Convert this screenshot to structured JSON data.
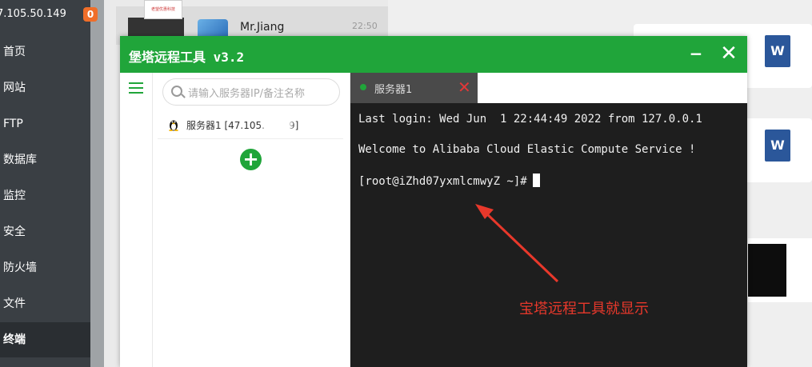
{
  "panel": {
    "ip": "7.105.50.149",
    "badge": "0",
    "nav": [
      "首页",
      "网站",
      "FTP",
      "数据库",
      "监控",
      "安全",
      "防火墙",
      "文件",
      "终端"
    ],
    "active_nav": "终端"
  },
  "chat": {
    "name": "Mr.Jiang",
    "time": "22:50",
    "thumb_text": "老望优惠科技",
    "doc_snippet": "…",
    "word_icon": "W"
  },
  "window": {
    "title": "堡塔远程工具 v3.2",
    "minimize_label": "−",
    "close_label": "✕",
    "search_placeholder": "请输入服务器IP/备注名称",
    "server": {
      "name": "服务器1 [47.105.",
      "name_tail": "9]"
    },
    "add_label": "+",
    "tab": {
      "label": "服务器1",
      "close": "✕"
    },
    "terminal": {
      "line1": "Last login: Wed Jun  1 22:44:49 2022 from 127.0.0.1",
      "line2": "Welcome to Alibaba Cloud Elastic Compute Service !",
      "prompt": "[root@iZhd07yxmlcmwyZ ~]#"
    }
  },
  "annotation": "宝塔远程工具就显示",
  "colors": {
    "brand": "#20a53a",
    "annotation": "#e8382b",
    "terminal_bg": "#1e1e1e"
  }
}
